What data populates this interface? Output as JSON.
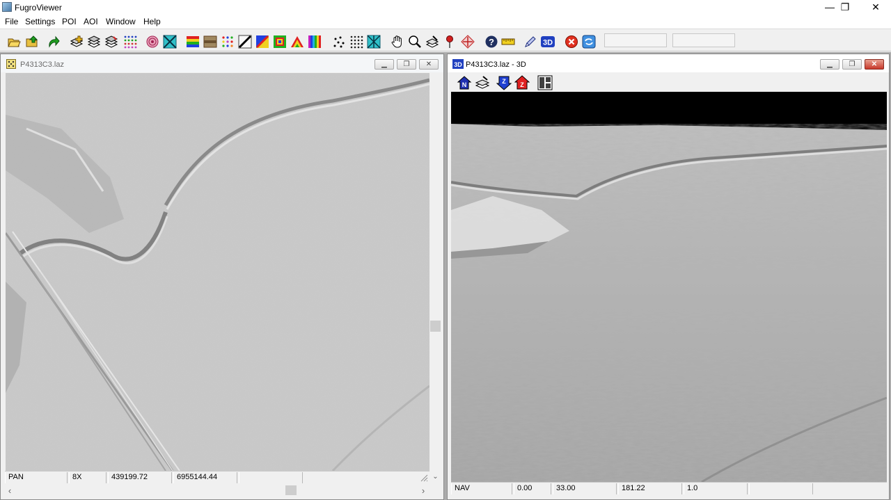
{
  "app": {
    "title": "FugroViewer",
    "controls": {
      "minimize": "—",
      "maximize": "❐",
      "close": "✕"
    }
  },
  "menu": [
    "File",
    "Settings",
    "POI",
    "AOI",
    "Window",
    "Help"
  ],
  "toolbar": {
    "icons": [
      "open-folder-icon",
      "open-file-icon",
      "redo-arrow-icon",
      "add-layer-icon",
      "layers-icon",
      "layers-edit-icon",
      "point-grid-icon",
      "target-rings-icon",
      "hillshade-icon",
      "elevation-bands-icon",
      "intensity-icon",
      "dots-color-icon",
      "diagonal-icon",
      "rgb-diagonal-icon",
      "color-square-icon",
      "rainbow-arrow-icon",
      "rainbow-bars-icon",
      "scatter-points-icon",
      "dense-grid-icon",
      "tin-surface-icon",
      "pan-hand-icon",
      "zoom-icon",
      "profile-layers-icon",
      "poi-pin-icon",
      "crosshair-icon",
      "help-question-icon",
      "ruler-icon",
      "pencil-icon",
      "3d-view-icon",
      "stop-icon",
      "refresh-icon"
    ]
  },
  "left_window": {
    "title": "P4313C3.laz",
    "status": {
      "mode": "PAN",
      "zoom": "8X",
      "x": "439199.72",
      "y": "6955144.44"
    }
  },
  "right_window": {
    "title": "P4313C3.laz - 3D",
    "tools": [
      "north-home-icon",
      "layer-tilt-icon",
      "z-down-icon",
      "z-up-icon",
      "split-view-icon"
    ],
    "status": {
      "mode": "NAV",
      "v1": "0.00",
      "v2": "33.00",
      "v3": "181.22",
      "v4": "1.0"
    }
  },
  "colors": {
    "terrain": "#b4b4b4",
    "sky": "#000000",
    "mdi_bg": "#ababab"
  }
}
